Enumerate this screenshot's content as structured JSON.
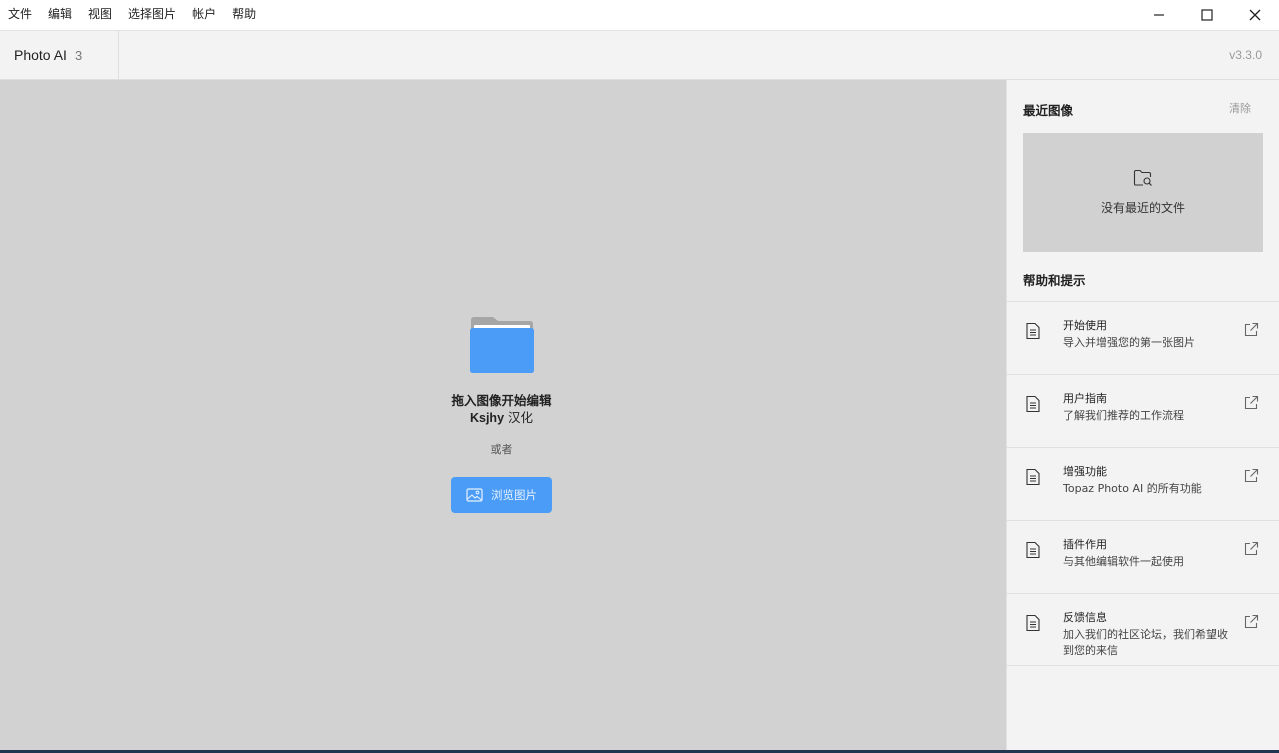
{
  "menu": {
    "items": [
      "文件",
      "编辑",
      "视图",
      "选择图片",
      "帐户",
      "帮助"
    ]
  },
  "window_controls": {
    "minimize_icon": "minimize-icon",
    "maximize_icon": "maximize-icon",
    "close_icon": "close-icon"
  },
  "header": {
    "app_name": "Photo AI",
    "app_major": "3",
    "version": "v3.3.0"
  },
  "main": {
    "drop_title": "拖入图像开始编辑",
    "drop_credit_bold": "Ksjhy",
    "drop_credit_rest": " 汉化",
    "or_text": "或者",
    "browse_label": "浏览图片",
    "folder_icon": "folder-icon",
    "accent": "#4a9cf6"
  },
  "side": {
    "recent_title": "最近图像",
    "clear_label": "清除",
    "recent_empty": "没有最近的文件",
    "help_title": "帮助和提示",
    "help_items": [
      {
        "title": "开始使用",
        "desc": "导入并增强您的第一张图片"
      },
      {
        "title": "用户指南",
        "desc": "了解我们推荐的工作流程"
      },
      {
        "title": "增强功能",
        "desc": "Topaz Photo AI 的所有功能"
      },
      {
        "title": "插件作用",
        "desc": "与其他编辑软件一起使用"
      },
      {
        "title": "反馈信息",
        "desc": "加入我们的社区论坛，我们希望收到您的来信"
      }
    ]
  }
}
